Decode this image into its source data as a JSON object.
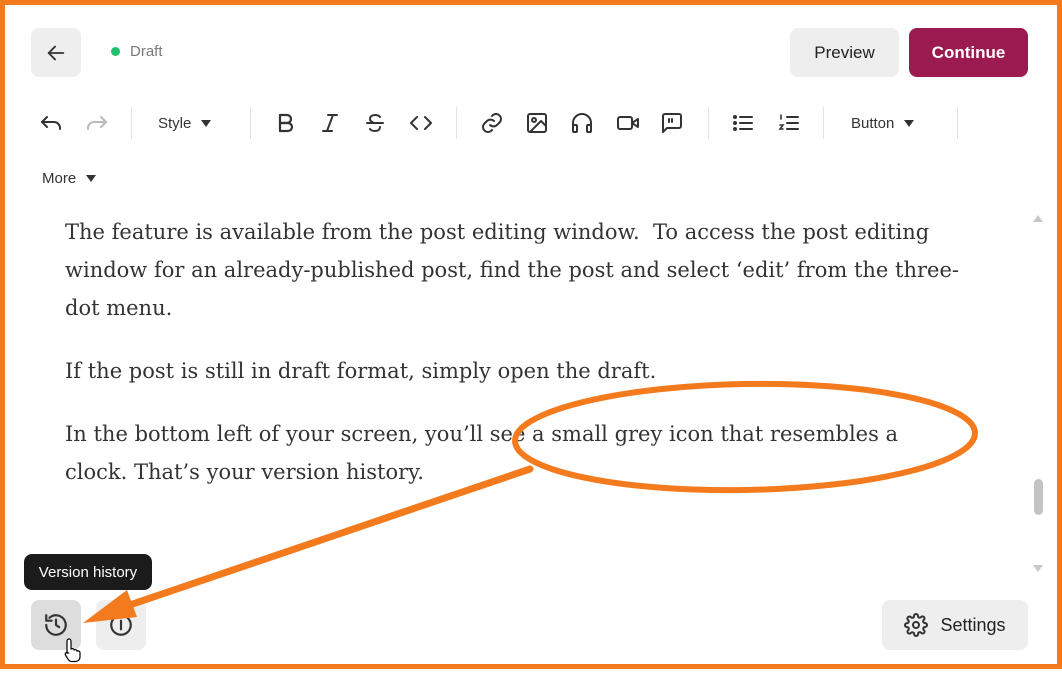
{
  "header": {
    "status_text": "Draft",
    "status_color": "#1fbf6b",
    "preview_label": "Preview",
    "continue_label": "Continue",
    "continue_color": "#9b1a50"
  },
  "toolbar": {
    "style_label": "Style",
    "button_label": "Button",
    "more_label": "More",
    "icons": [
      "undo-icon",
      "redo-icon",
      "bold-icon",
      "italic-icon",
      "strikethrough-icon",
      "code-icon",
      "link-icon",
      "image-icon",
      "audio-icon",
      "video-icon",
      "quote-icon",
      "bullet-list-icon",
      "numbered-list-icon"
    ]
  },
  "content": {
    "paragraphs": [
      "The feature is available from the post editing window.  To access the post editing window for an already-published post, find the post and select ‘edit’ from the three-dot menu.",
      "If the post is still in draft format, simply open the draft.",
      "In the bottom left of your screen, you’ll see a small grey icon that resembles a clock. That’s your version history."
    ]
  },
  "footer": {
    "tooltip_text": "Version history",
    "settings_label": "Settings"
  },
  "annotation": {
    "color": "#f47a1e"
  }
}
